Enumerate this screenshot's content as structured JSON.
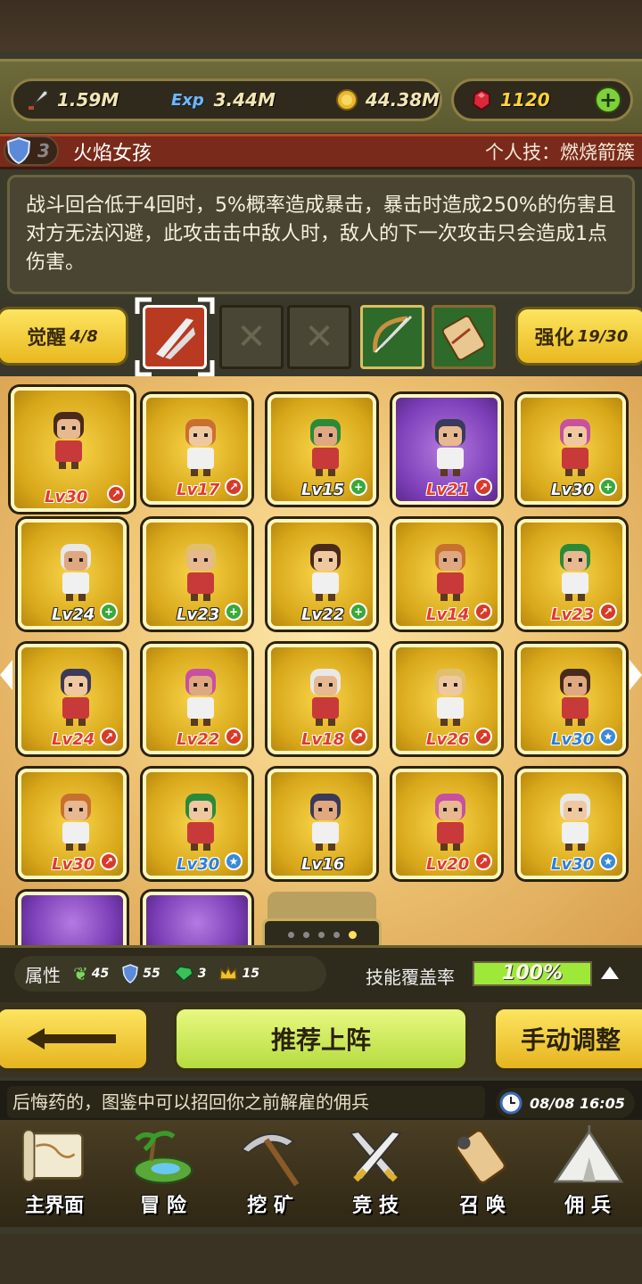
{
  "resources": {
    "attack": "1.59M",
    "exp": "3.44M",
    "gold": "44.38M",
    "gems": "1120",
    "exp_icon_label": "Exp"
  },
  "hero": {
    "rank": "3",
    "name": "火焰女孩",
    "skill_label": "个人技：燃烧箭簇",
    "description": "战斗回合低于4回时，5%概率造成暴击，暴击时造成250%的伤害且对方无法闪避，此攻击击中敌人时，敌人的下一次攻击只会造成1点伤害。"
  },
  "awaken": {
    "label": "觉醒",
    "value": "4/8"
  },
  "enhance": {
    "label": "强化",
    "value": "19/30"
  },
  "cards": [
    {
      "level": "Lv30",
      "lv_style": "red",
      "badge": "arrow",
      "color": "gold"
    },
    {
      "level": "Lv17",
      "lv_style": "red",
      "badge": "arrow",
      "color": "gold"
    },
    {
      "level": "Lv15",
      "lv_style": "green",
      "badge": "plus",
      "color": "gold"
    },
    {
      "level": "Lv21",
      "lv_style": "red",
      "badge": "arrow",
      "color": "purple"
    },
    {
      "level": "Lv30",
      "lv_style": "green",
      "badge": "plus",
      "color": "gold"
    },
    {
      "level": "Lv24",
      "lv_style": "green",
      "badge": "plus",
      "color": "gold"
    },
    {
      "level": "Lv23",
      "lv_style": "green",
      "badge": "plus",
      "color": "gold"
    },
    {
      "level": "Lv22",
      "lv_style": "green",
      "badge": "plus",
      "color": "gold"
    },
    {
      "level": "Lv14",
      "lv_style": "red",
      "badge": "arrow",
      "color": "gold"
    },
    {
      "level": "Lv23",
      "lv_style": "red",
      "badge": "arrow",
      "color": "gold"
    },
    {
      "level": "Lv24",
      "lv_style": "red",
      "badge": "arrow",
      "color": "gold"
    },
    {
      "level": "Lv22",
      "lv_style": "red",
      "badge": "arrow",
      "color": "gold"
    },
    {
      "level": "Lv18",
      "lv_style": "red",
      "badge": "arrow",
      "color": "gold"
    },
    {
      "level": "Lv26",
      "lv_style": "red",
      "badge": "arrow",
      "color": "gold"
    },
    {
      "level": "Lv30",
      "lv_style": "blue",
      "badge": "star",
      "color": "gold"
    },
    {
      "level": "Lv30",
      "lv_style": "red",
      "badge": "arrow",
      "color": "gold"
    },
    {
      "level": "Lv30",
      "lv_style": "blue",
      "badge": "star",
      "color": "gold"
    },
    {
      "level": "Lv16",
      "lv_style": "green",
      "badge": "",
      "color": "gold"
    },
    {
      "level": "Lv20",
      "lv_style": "red",
      "badge": "arrow",
      "color": "gold"
    },
    {
      "level": "Lv30",
      "lv_style": "blue",
      "badge": "star",
      "color": "gold"
    }
  ],
  "attributes": {
    "label": "属性",
    "wind": "45",
    "shield": "55",
    "gem": "3",
    "crown": "15",
    "coverage_label": "技能覆盖率",
    "coverage_value": "100%",
    "coverage_fraction": 1.0
  },
  "buttons": {
    "recommend": "推荐上阵",
    "manual": "手动调整"
  },
  "ticker": {
    "text": "后悔药的，图鉴中可以招回你之前解雇的佣兵",
    "time": "08/08 16:05"
  },
  "nav": [
    {
      "label": "主界面",
      "icon": "map-icon"
    },
    {
      "label": "冒 险",
      "icon": "island-icon"
    },
    {
      "label": "挖 矿",
      "icon": "pickaxe-icon"
    },
    {
      "label": "竞 技",
      "icon": "crossed-swords-icon"
    },
    {
      "label": "召 唤",
      "icon": "scroll-icon"
    },
    {
      "label": "佣 兵",
      "icon": "tent-icon"
    }
  ],
  "colors": {
    "gold_card": "#f2c630",
    "purple_card": "#8d4fc7",
    "name_bar": "#7a2a1a",
    "coverage_bar": "#9ee83a"
  }
}
